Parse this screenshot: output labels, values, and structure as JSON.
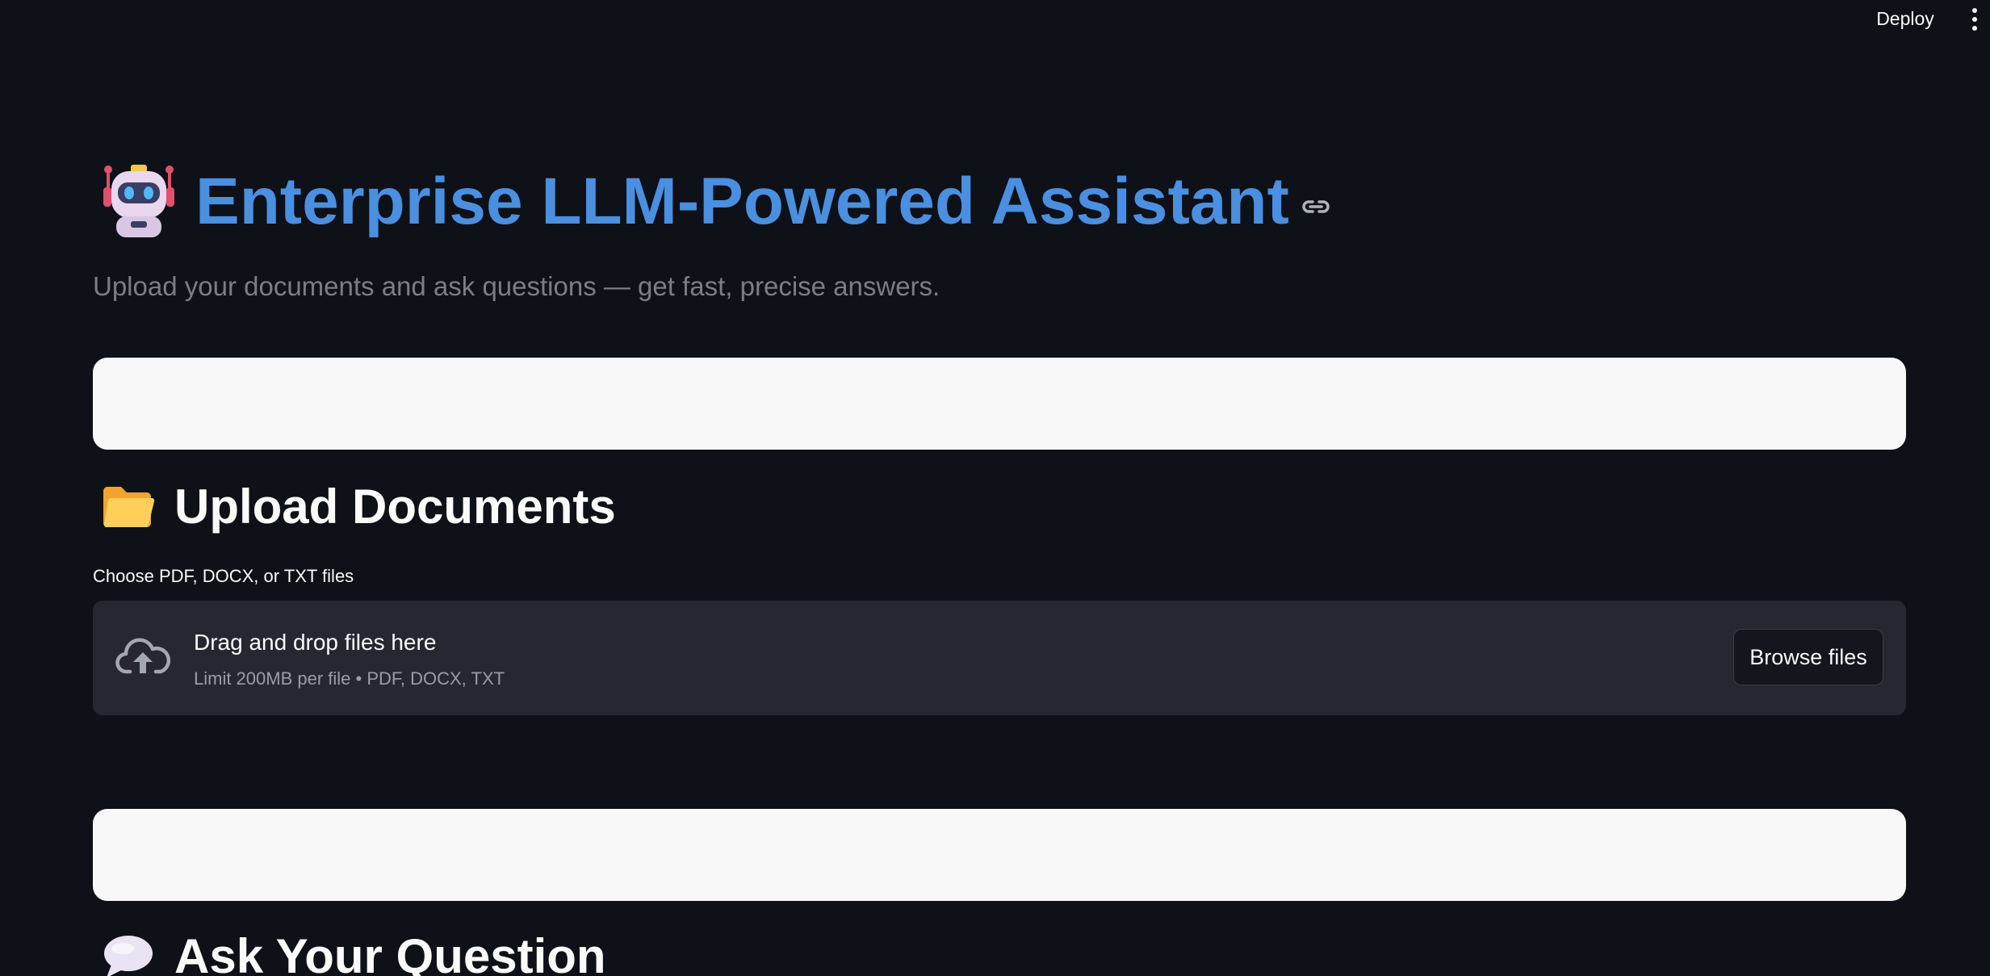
{
  "toolbar": {
    "deploy_label": "Deploy",
    "menu_icon": "more-vertical-icon"
  },
  "header": {
    "title": "Enterprise LLM-Powered Assistant",
    "title_icon": "robot-icon",
    "anchor_icon": "link-icon",
    "subtitle": "Upload your documents and ask questions — get fast, precise answers."
  },
  "upload_section": {
    "icon": "open-folder-icon",
    "heading": "Upload Documents",
    "uploader": {
      "label": "Choose PDF, DOCX, or TXT files",
      "icon": "cloud-upload-icon",
      "drop_text": "Drag and drop files here",
      "limit_text": "Limit 200MB per file • PDF, DOCX, TXT",
      "browse_label": "Browse files"
    }
  },
  "ask_section": {
    "icon": "speech-bubble-icon",
    "heading": "Ask Your Question"
  },
  "colors": {
    "background": "#0e1117",
    "title_accent": "#4a8fe0",
    "panel": "#262730",
    "blank_bar": "#f8f8f9"
  }
}
